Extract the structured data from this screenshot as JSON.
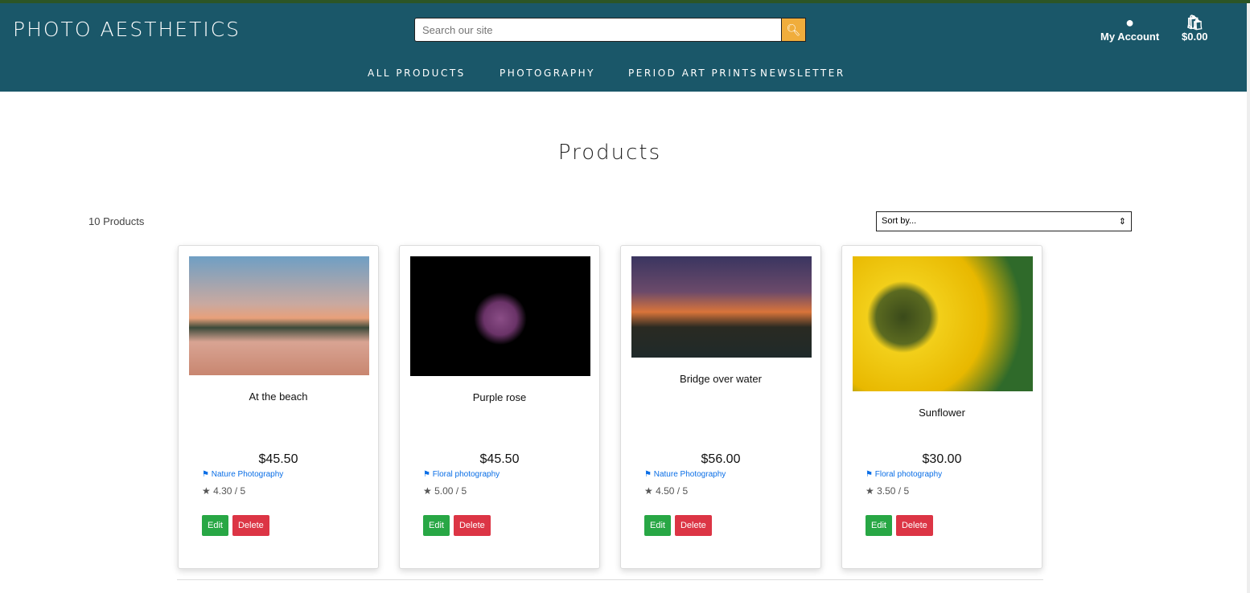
{
  "header": {
    "logo": "PHOTO AESTHETICS",
    "search_placeholder": "Search our site",
    "account_label": "My Account",
    "cart_total": "$0.00"
  },
  "nav": [
    "ALL PRODUCTS",
    "PHOTOGRAPHY",
    "PERIOD ART PRINTS",
    "NEWSLETTER"
  ],
  "page": {
    "title": "Products",
    "count": "10 Products",
    "sort_value": "Sort by..."
  },
  "products": [
    {
      "title": "At the beach",
      "price": "$45.50",
      "category": "Nature Photography",
      "rating": "4.30 / 5"
    },
    {
      "title": "Purple rose",
      "price": "$45.50",
      "category": "Floral photography",
      "rating": "5.00 / 5"
    },
    {
      "title": "Bridge over water",
      "price": "$56.00",
      "category": "Nature Photography",
      "rating": "4.50 / 5"
    },
    {
      "title": "Sunflower",
      "price": "$30.00",
      "category": "Floral photography",
      "rating": "3.50 / 5"
    }
  ],
  "buttons": {
    "edit": "Edit",
    "delete": "Delete"
  }
}
